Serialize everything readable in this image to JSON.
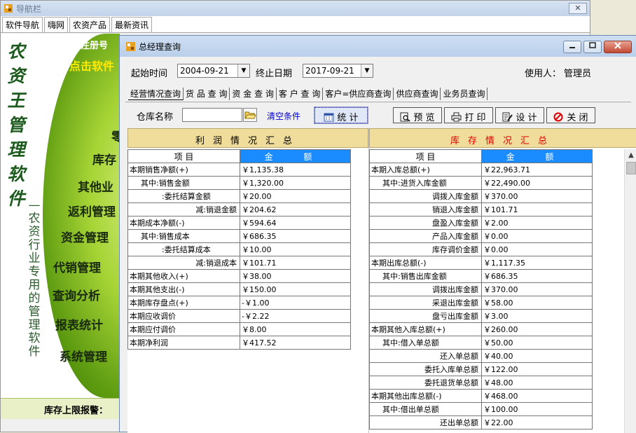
{
  "bg_window": {
    "title": "导航栏",
    "close_label": "✕",
    "tabs": [
      "软件导航",
      "嗨网",
      "农资产品",
      "最新资讯"
    ]
  },
  "sidebar": {
    "logo_big": [
      "农",
      "资",
      "王",
      "管",
      "理",
      "软",
      "件"
    ],
    "logo_small": [
      "—",
      "农",
      "资",
      "行",
      "业",
      "专",
      "用",
      "的",
      "管",
      "理",
      "软",
      "件"
    ],
    "reg_text": "软件注册号",
    "click_text": "点击软件",
    "menu": [
      "零",
      "库存",
      "其他业",
      "返利管理",
      "资金管理",
      "代销管理",
      "查询分析",
      "报表统计",
      "系统管理"
    ],
    "stock_alarm": "库存上限报警："
  },
  "dialog": {
    "title": "总经理查询",
    "start_label": "起始时间",
    "start_date": "2004-09-21",
    "end_label": "终止日期",
    "end_date": "2017-09-21",
    "user_label": "使用人：",
    "user_name": "管理员",
    "tabs": [
      "经营情况查询",
      "货 品 查 询",
      "资 金 查 询",
      "客 户 查 询",
      "客户=供应商查询",
      "供应商查询",
      "业务员查询"
    ],
    "warehouse_label": "仓库名称",
    "warehouse_value": "",
    "clear_label": "清空条件",
    "buttons": {
      "stat": "统 计",
      "preview": "预 览",
      "print": "打 印",
      "design": "设 计",
      "close": "关 闭"
    }
  },
  "profit": {
    "title": "利润情况汇总",
    "col_item": "项      目",
    "col_amount": "金  额",
    "rows": [
      {
        "item": "本期销售净额(+)",
        "amount": "￥1,135.38",
        "indent": 0
      },
      {
        "item": "其中:销售金额",
        "amount": "￥1,320.00",
        "indent": 1
      },
      {
        "item": ":委托结算金额",
        "amount": "￥20.00",
        "indent": 2
      },
      {
        "item": "减:销退金额",
        "amount": "￥204.62",
        "indent": 3
      },
      {
        "item": "本期成本净额(-)",
        "amount": "￥594.64",
        "indent": 0
      },
      {
        "item": "其中:销售成本",
        "amount": "￥686.35",
        "indent": 1
      },
      {
        "item": ":委托结算成本",
        "amount": "￥10.00",
        "indent": 2
      },
      {
        "item": "减:销退成本",
        "amount": "￥101.71",
        "indent": 3
      },
      {
        "item": "本期其他收入(+)",
        "amount": "￥38.00",
        "indent": 0
      },
      {
        "item": "本期其他支出(-)",
        "amount": "￥150.00",
        "indent": 0
      },
      {
        "item": "本期库存盘点(+)",
        "amount": "-￥1.00",
        "indent": 0
      },
      {
        "item": "本期应收调价",
        "amount": "-￥2.22",
        "indent": 0
      },
      {
        "item": "本期应付调价",
        "amount": "￥8.00",
        "indent": 0
      },
      {
        "item": "本期净利润",
        "amount": "￥417.52",
        "indent": 0
      }
    ]
  },
  "stock": {
    "title": "库存情况汇总",
    "col_item": "项      目",
    "col_amount": "金  额",
    "rows": [
      {
        "item": "本期入库总额(+)",
        "amount": "￥22,963.71",
        "indent": 0
      },
      {
        "item": "其中:进货入库金额",
        "amount": "￥22,490.00",
        "indent": 1
      },
      {
        "item": "调拨入库金额",
        "amount": "￥370.00",
        "indent": 3
      },
      {
        "item": "销退入库金额",
        "amount": "￥101.71",
        "indent": 3
      },
      {
        "item": "盘盈入库金额",
        "amount": "￥2.00",
        "indent": 3
      },
      {
        "item": "产品入库金额",
        "amount": "￥0.00",
        "indent": 3
      },
      {
        "item": "库存调价金额",
        "amount": "￥0.00",
        "indent": 3
      },
      {
        "item": "本期出库总额(-)",
        "amount": "￥1,117.35",
        "indent": 0
      },
      {
        "item": "其中:销售出库金额",
        "amount": "￥686.35",
        "indent": 1
      },
      {
        "item": "调拨出库金额",
        "amount": "￥370.00",
        "indent": 3
      },
      {
        "item": "采退出库金额",
        "amount": "￥58.00",
        "indent": 3
      },
      {
        "item": "盘亏出库金额",
        "amount": "￥3.00",
        "indent": 3
      },
      {
        "item": "本期其他入库总额(+)",
        "amount": "￥260.00",
        "indent": 0
      },
      {
        "item": "其中:借入单总额",
        "amount": "￥50.00",
        "indent": 1
      },
      {
        "item": "还入单总额",
        "amount": "￥40.00",
        "indent": 3
      },
      {
        "item": "委托入库单总额",
        "amount": "￥122.00",
        "indent": 3
      },
      {
        "item": "委托退货单总额",
        "amount": "￥48.00",
        "indent": 3
      },
      {
        "item": "本期其他出库总额(-)",
        "amount": "￥468.00",
        "indent": 0
      },
      {
        "item": "其中:借出单总额",
        "amount": "￥100.00",
        "indent": 1
      },
      {
        "item": "还出单总额",
        "amount": "￥22.00",
        "indent": 3
      }
    ]
  },
  "colors": {
    "section_header_bg": "#f0dc9b",
    "amount_header_bg": "#1a8cff",
    "stock_title_color": "#e00000",
    "link_color": "#0000cc"
  }
}
